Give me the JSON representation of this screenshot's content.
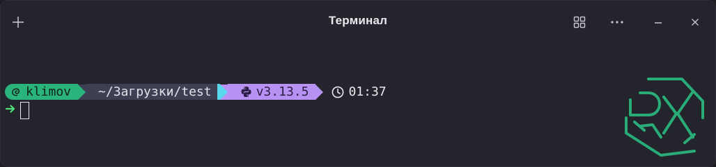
{
  "window": {
    "title": "Терминал"
  },
  "titlebar": {
    "new_tab_icon": "plus-icon",
    "overview_icon": "grid-icon",
    "menu_icon": "ellipsis-icon",
    "minimize_icon": "minimize-icon",
    "close_icon": "close-icon"
  },
  "prompt": {
    "user": "klimov",
    "user_icon": "debian-swirl-icon",
    "path": "~/Загрузки/test",
    "python_icon": "python-icon",
    "python_version": "v3.13.5",
    "clock_icon": "clock-icon",
    "time": "01:37",
    "continuation_icon": "arrow-right-icon"
  },
  "colors": {
    "window_bg": "#24252c",
    "user_segment": "#2ab47c",
    "path_segment": "#3d3f52",
    "separator_accent": "#5ad9ee",
    "python_segment": "#b892f3",
    "prompt_arrow": "#4fe07a",
    "logo_green": "#2ab47c"
  }
}
